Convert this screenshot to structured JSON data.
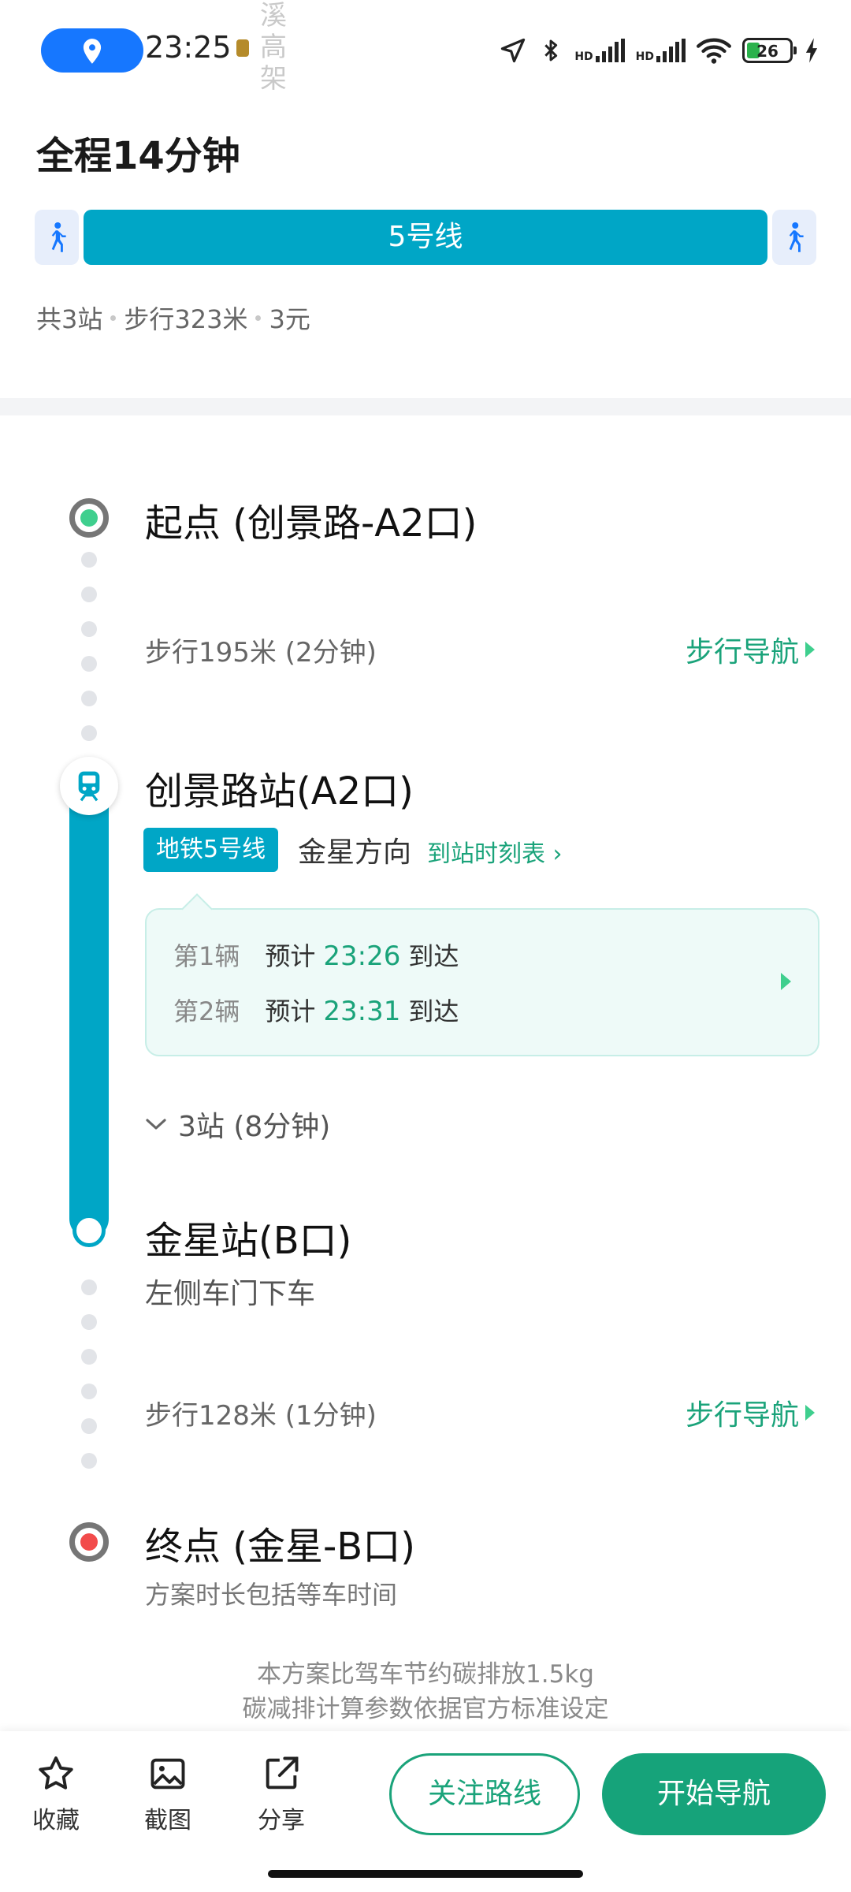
{
  "status_bar": {
    "time": "23:25",
    "watermark": "溪高架",
    "hd1": "HD",
    "hd2": "HD",
    "battery": "26",
    "icons": [
      "location-pill-icon",
      "navigation-arrow-icon",
      "bluetooth-icon",
      "signal-icon",
      "wifi-icon",
      "battery-icon",
      "charging-icon"
    ]
  },
  "summary": {
    "title": "全程14分钟",
    "line_label": "5号线",
    "stops": "共3站",
    "walk": "步行323米",
    "fare": "3元"
  },
  "timeline": {
    "start": {
      "title": "起点 (创景路-A2口)",
      "walk": "步行195米 (2分钟)",
      "walk_nav": "步行导航"
    },
    "board": {
      "title": "创景路站(A2口)",
      "line_badge": "地铁5号线",
      "direction": "金星方向",
      "timetable": "到站时刻表 ›"
    },
    "arrivals": [
      {
        "index": "第1辆",
        "label": "预计",
        "time": "23:26",
        "suffix": "到达"
      },
      {
        "index": "第2辆",
        "label": "预计",
        "time": "23:31",
        "suffix": "到达"
      }
    ],
    "stops_toggle": "3站 (8分钟)",
    "alight": {
      "title": "金星站(B口)",
      "note": "左侧车门下车",
      "walk": "步行128米 (1分钟)",
      "walk_nav": "步行导航"
    },
    "end": {
      "title": "终点 (金星-B口)",
      "note": "方案时长包括等车时间"
    }
  },
  "carbon": {
    "line1": "本方案比驾车节约碳排放1.5kg",
    "line2": "碳减排计算参数依据官方标准设定"
  },
  "bottom_bar": {
    "favorite": "收藏",
    "screenshot": "截图",
    "share": "分享",
    "follow": "关注路线",
    "start": "开始导航"
  },
  "colors": {
    "metro_line": "#00a6c6",
    "accent_green": "#1aa37a",
    "start_dot": "#3fcf8e",
    "end_dot": "#f24b4b",
    "status_pill": "#1677ff"
  }
}
